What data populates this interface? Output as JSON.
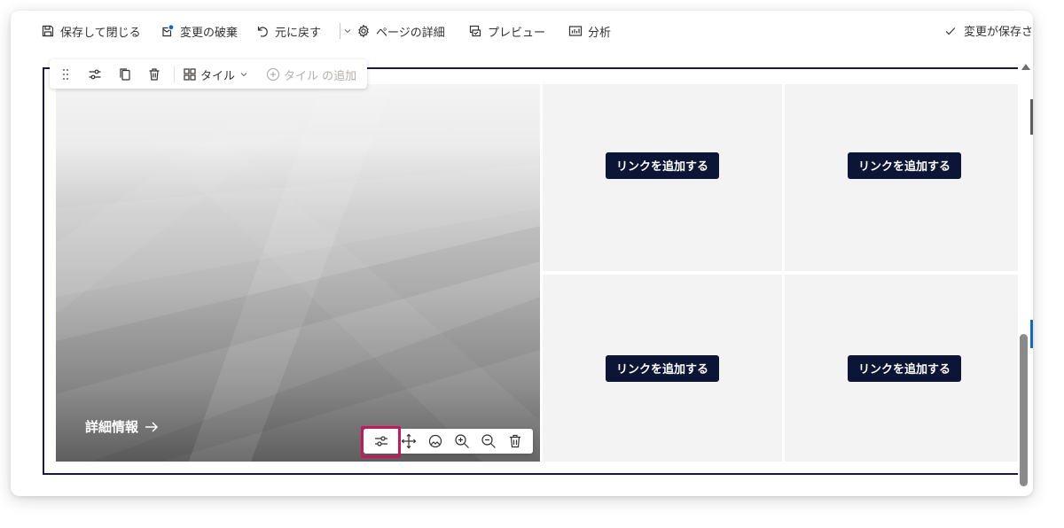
{
  "commandbar": {
    "save_close": "保存して閉じる",
    "discard": "変更の破棄",
    "undo": "元に戻す",
    "page_details": "ページの詳細",
    "preview": "プレビュー",
    "analytics": "分析",
    "saved_status": "変更が保存さ"
  },
  "section_toolbar": {
    "layout_label": "タイル",
    "add_tile_label": "タイル の追加"
  },
  "hero": {
    "link_text": "詳細情報"
  },
  "tiles": [
    {
      "label": "リンクを追加する"
    },
    {
      "label": "リンクを追加する"
    },
    {
      "label": "リンクを追加する"
    },
    {
      "label": "リンクを追加する"
    }
  ],
  "colors": {
    "accent_dark": "#0c1536",
    "highlight": "#c3195d",
    "section_border": "#1b1a3d"
  }
}
